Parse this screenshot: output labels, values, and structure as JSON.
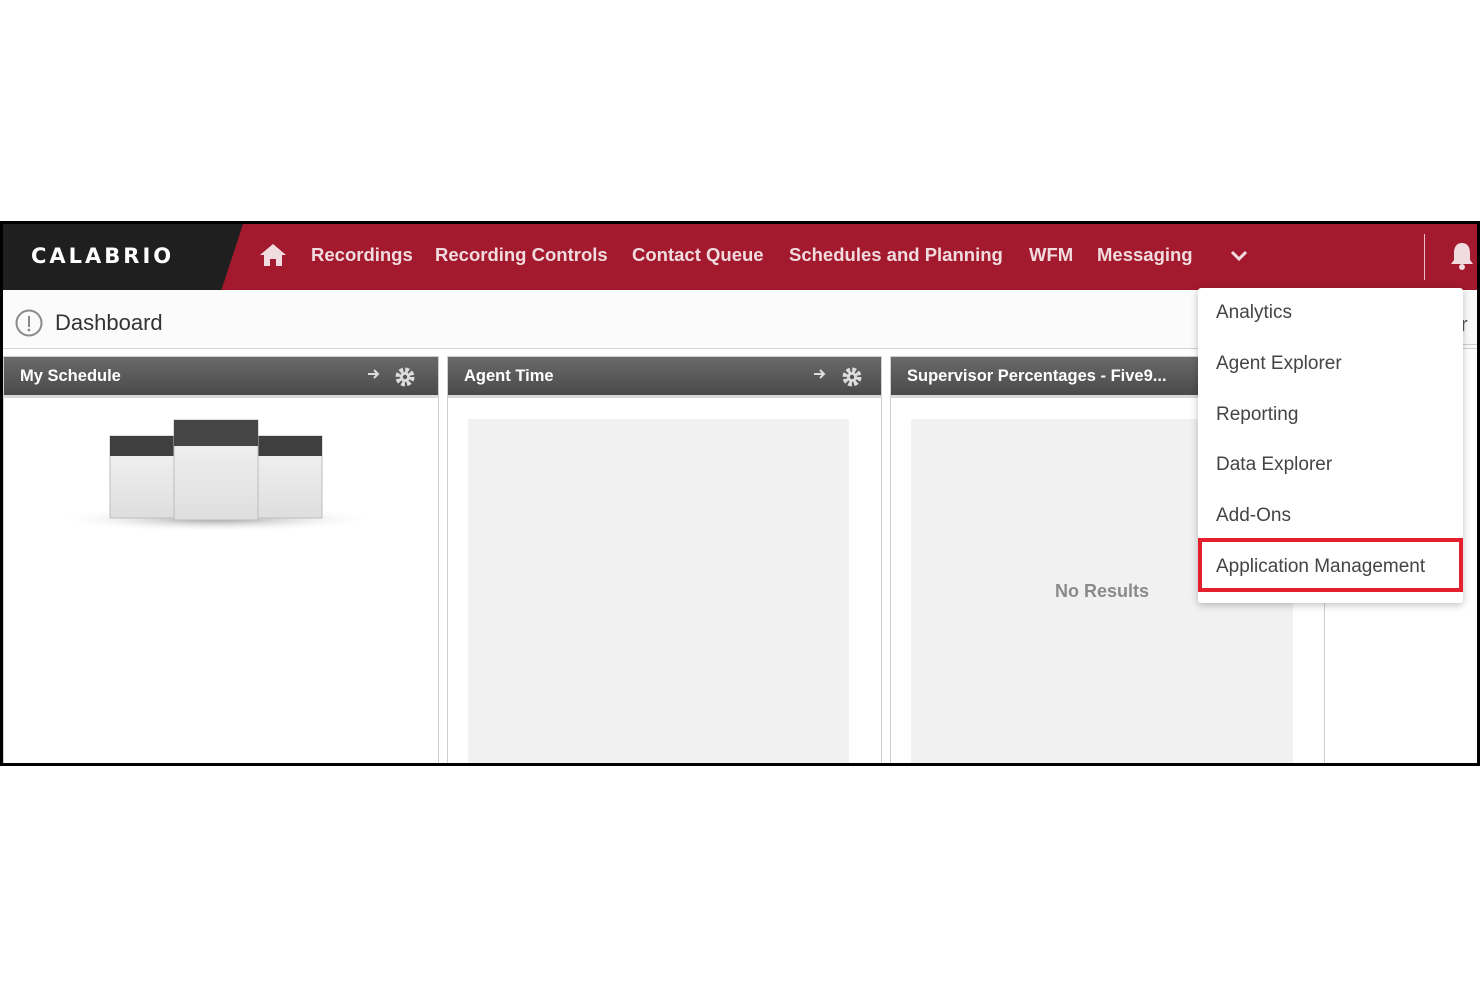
{
  "brand": {
    "name": "CALABRIO"
  },
  "nav": {
    "items": [
      "Recordings",
      "Recording Controls",
      "Contact Queue",
      "Schedules and Planning",
      "WFM",
      "Messaging"
    ],
    "home_icon": "home-icon",
    "more_icon": "chevron-down-icon",
    "bell_icon": "bell-icon"
  },
  "page": {
    "title": "Dashboard",
    "info_icon": "info-icon",
    "cut_text": "r"
  },
  "widgets": [
    {
      "title": "My Schedule",
      "icons": [
        "arrow-right-icon",
        "gear-icon"
      ]
    },
    {
      "title": "Agent Time",
      "icons": [
        "arrow-right-icon",
        "gear-icon"
      ]
    },
    {
      "title": "Supervisor Percentages - Five9...",
      "empty_text": "No Results"
    }
  ],
  "menu": {
    "items": [
      "Analytics",
      "Agent Explorer",
      "Reporting",
      "Data Explorer",
      "Add-Ons",
      "Application Management"
    ],
    "highlighted": "Application Management"
  },
  "colors": {
    "nav_bg": "#a3192d",
    "brand_bg": "#1f1f1f",
    "highlight": "#e5202e",
    "widget_header": "#555555"
  }
}
